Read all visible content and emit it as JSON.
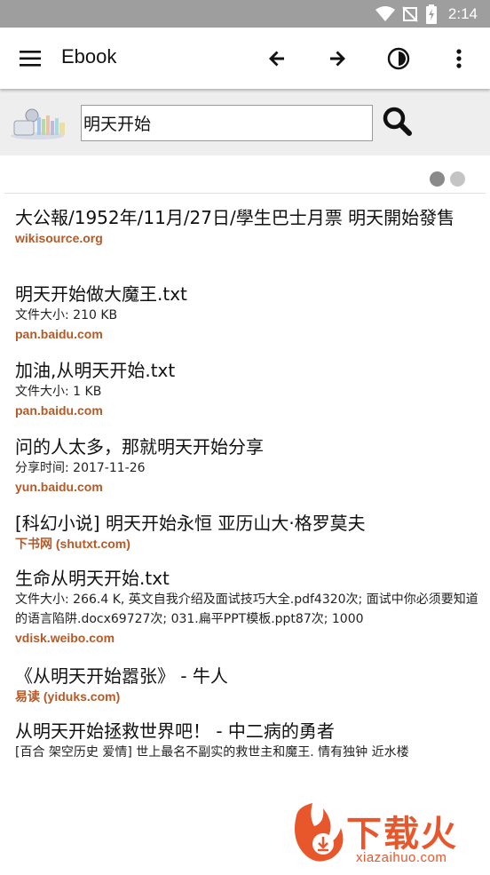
{
  "status_bar": {
    "time": "2:14"
  },
  "app_bar": {
    "title": "Ebook"
  },
  "search": {
    "query": "明天开始"
  },
  "page_indicator": {
    "active_color": "#8a8a8a",
    "inactive_color": "#c4c4c4"
  },
  "results": [
    {
      "title": "大公報/1952年/11月/27日/學生巴士月票 明天開始發售",
      "snippet": "",
      "source": "wikisource.org"
    },
    {
      "title": "明天开始做大魔王.txt",
      "snippet": "文件大小: 210 KB",
      "source": "pan.baidu.com"
    },
    {
      "title": "加油,从明天开始.txt",
      "snippet": "文件大小: 1 KB",
      "source": "pan.baidu.com"
    },
    {
      "title": "问的人太多，那就明天开始分享",
      "snippet": "分享时间: 2017-11-26",
      "source": "yun.baidu.com"
    },
    {
      "title": "[科幻小说] 明天开始永恒 亚历山大·格罗莫夫",
      "snippet": "",
      "source": "下书网 (shutxt.com)"
    },
    {
      "title": "生命从明天开始.txt",
      "snippet": "文件大小: 266.4 K, 英文自我介绍及面试技巧大全.pdf4320次; 面试中你必须要知道的语言陷阱.docx69727次; 031.扁平PPT模板.ppt87次; 1000",
      "source": "vdisk.weibo.com"
    },
    {
      "title": "《从明天开始嚣张》 - 牛人",
      "snippet": "",
      "source": "易读 (yiduks.com)"
    },
    {
      "title": "从明天开始拯救世界吧！ - 中二病的勇者",
      "snippet": "[百合 架空历史 爱情] 世上最名不副实的救世主和魔王. 情有独钟 近水楼",
      "source": ""
    }
  ],
  "watermark": {
    "text": "下载火",
    "url": "xiazaihuo.com"
  },
  "colors": {
    "source": "#b35a28",
    "status_bar": "#9e9e9e",
    "search_bg": "#eeeeee",
    "watermark": "#e8562c"
  }
}
